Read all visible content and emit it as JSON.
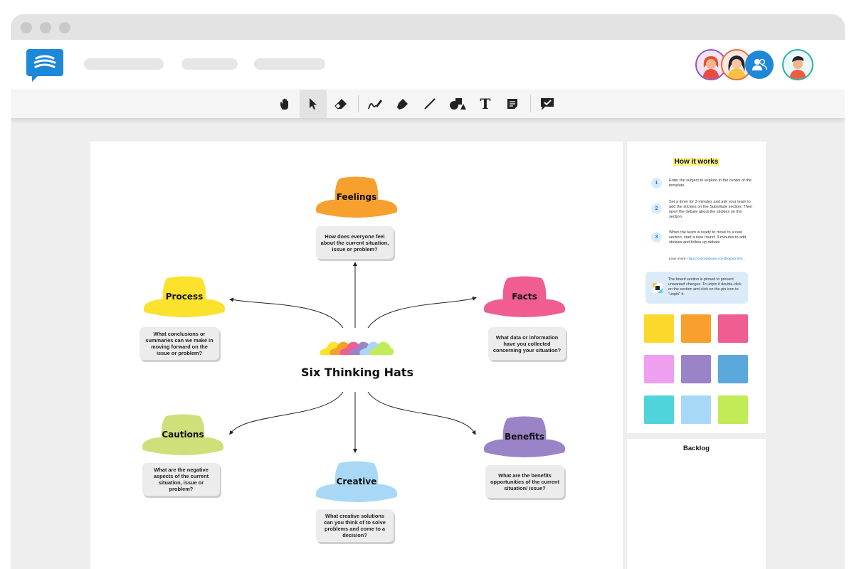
{
  "app": {
    "nav_pills": [
      "",
      "",
      ""
    ]
  },
  "toolbar": {
    "tools": [
      "hand-tool",
      "select-tool",
      "eraser-tool",
      "pen-tool",
      "highlighter-tool",
      "line-tool",
      "shapes-tool",
      "text-tool",
      "sticky-note-tool",
      "feedback-tool"
    ],
    "active": "select-tool",
    "text_tool_glyph": "T"
  },
  "board": {
    "title": "Six Thinking Hats",
    "hats": [
      {
        "id": "feelings",
        "label": "Feelings",
        "color": "#f7a02e",
        "question": "How does everyone feel about the current situation, issue or problem?"
      },
      {
        "id": "process",
        "label": "Process",
        "color": "#fbe22c",
        "question": "What conclusions or summaries can we make in moving forward on the issue or problem?"
      },
      {
        "id": "facts",
        "label": "Facts",
        "color": "#ef5d92",
        "question": "What data or information have you collected concerning your situation?"
      },
      {
        "id": "cautions",
        "label": "Cautions",
        "color": "#cfe07a",
        "question": "What are the negative aspects of the current situation, issue or problem?"
      },
      {
        "id": "creative",
        "label": "Creative",
        "color": "#a8d8f5",
        "question": "What creative solutions can you think of to solve problems and come to a decision?"
      },
      {
        "id": "benefits",
        "label": "Benefits",
        "color": "#9b83c7",
        "question": "What are the benefits opportunities of the current situation/ issue?"
      }
    ]
  },
  "how_it_works": {
    "title": "How it works",
    "steps": [
      {
        "num": "1",
        "text": "Enter the subject to explore in the center of the template."
      },
      {
        "num": "2",
        "text": "Set a timer for 3 minutes and ask your team to add the stickies on the Substitute section. Then open the debate about the stickies on the section."
      },
      {
        "num": "3",
        "text": "When the team is ready to move to a new section, start a new round: 3 minutes to add stickies and follow up debate"
      }
    ],
    "learn_more_label": "Learn more:",
    "learn_more_link": "https://conceptboard.com/blog/six-thin...",
    "pinned_note": "The board section is pinned to prevent unwanted changes. To unpin it double-click on the section and click on the pin icon to \"unpin\" it."
  },
  "stickies": {
    "colors": [
      "#fbd92c",
      "#f7a02e",
      "#ef5d92",
      "#ef9ff0",
      "#9b83c7",
      "#5aa8dc",
      "#4fd4dc",
      "#a8d8f8",
      "#c2ec55"
    ]
  },
  "backlog": {
    "title": "Backlog"
  },
  "colors": {
    "brand": "#1e88d8",
    "window_bg": "#eeeeee",
    "titlebar": "#e3e3e3"
  }
}
